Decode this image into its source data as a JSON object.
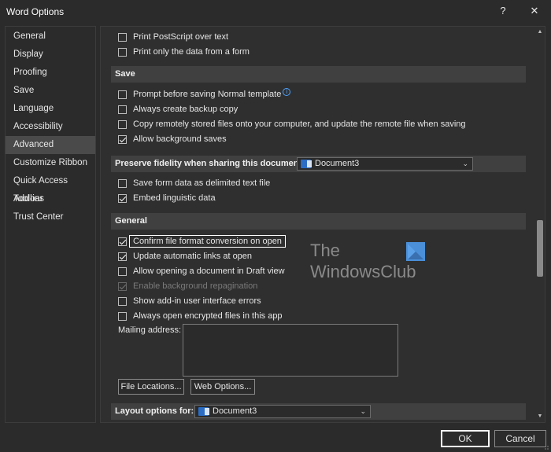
{
  "window": {
    "title": "Word Options",
    "help_label": "?",
    "close_label": "✕"
  },
  "sidebar": {
    "items": [
      {
        "label": "General"
      },
      {
        "label": "Display"
      },
      {
        "label": "Proofing"
      },
      {
        "label": "Save"
      },
      {
        "label": "Language"
      },
      {
        "label": "Accessibility"
      },
      {
        "label": "Advanced"
      },
      {
        "label": "Customize Ribbon"
      },
      {
        "label": "Quick Access Toolbar"
      },
      {
        "label": "Add-ins"
      },
      {
        "label": "Trust Center"
      }
    ],
    "active": "Advanced"
  },
  "print_options": {
    "postscript": {
      "label": "Print PostScript over text",
      "checked": false
    },
    "form_data_only": {
      "label": "Print only the data from a form",
      "checked": false
    }
  },
  "save_section": {
    "header": "Save",
    "prompt_normal": {
      "label": "Prompt before saving Normal template",
      "checked": false
    },
    "backup_copy": {
      "label": "Always create backup copy",
      "checked": false
    },
    "copy_remote": {
      "label": "Copy remotely stored files onto your computer, and update the remote file when saving",
      "checked": false
    },
    "background_saves": {
      "label": "Allow background saves",
      "checked": true
    }
  },
  "fidelity_section": {
    "header": "Preserve fidelity when sharing this document:",
    "document": "Document3",
    "save_form_data": {
      "label": "Save form data as delimited text file",
      "checked": false
    },
    "embed_linguistic": {
      "label": "Embed linguistic data",
      "checked": true
    }
  },
  "general_section": {
    "header": "General",
    "confirm_conversion": {
      "label": "Confirm file format conversion on open",
      "checked": true
    },
    "update_links": {
      "label": "Update automatic links at open",
      "checked": true
    },
    "draft_view": {
      "label": "Allow opening a document in Draft view",
      "checked": false
    },
    "background_repagination": {
      "label": "Enable background repagination",
      "checked": true
    },
    "addin_errors": {
      "label": "Show add-in user interface errors",
      "checked": false
    },
    "encrypted_files": {
      "label": "Always open encrypted files in this app",
      "checked": false
    },
    "mailing_address_label": "Mailing address:",
    "mailing_address_value": "",
    "file_locations_button": "File Locations...",
    "web_options_button": "Web Options..."
  },
  "layout_section": {
    "header": "Layout options for:",
    "document": "Document3"
  },
  "watermark": {
    "line1": "The",
    "line2": "WindowsClub"
  },
  "footer": {
    "ok_label": "OK",
    "cancel_label": "Cancel"
  },
  "colors": {
    "background": "#2b2b2b",
    "section_header": "#404040",
    "accent_blue": "#2b6cc4"
  }
}
